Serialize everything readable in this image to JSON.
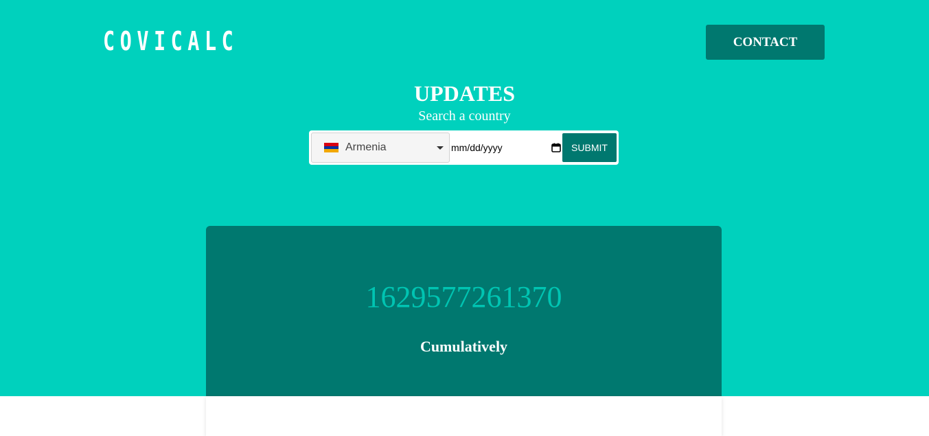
{
  "header": {
    "logo": "COVICALC",
    "contact_label": "CONTACT"
  },
  "hero": {
    "title": "UPDATES",
    "search_label": "Search a country"
  },
  "search": {
    "country": "Armenia",
    "country_flag_colors": [
      "#d90012",
      "#0033a0",
      "#f2a800"
    ],
    "date_placeholder": "mm/dd/yyyy",
    "submit_label": "SUBMIT"
  },
  "stats": {
    "value": "1629577261370",
    "caption": "Cumulatively"
  },
  "colors": {
    "primary": "#00d1bd",
    "dark_teal": "#00786f",
    "number_color": "#00c4b2"
  }
}
